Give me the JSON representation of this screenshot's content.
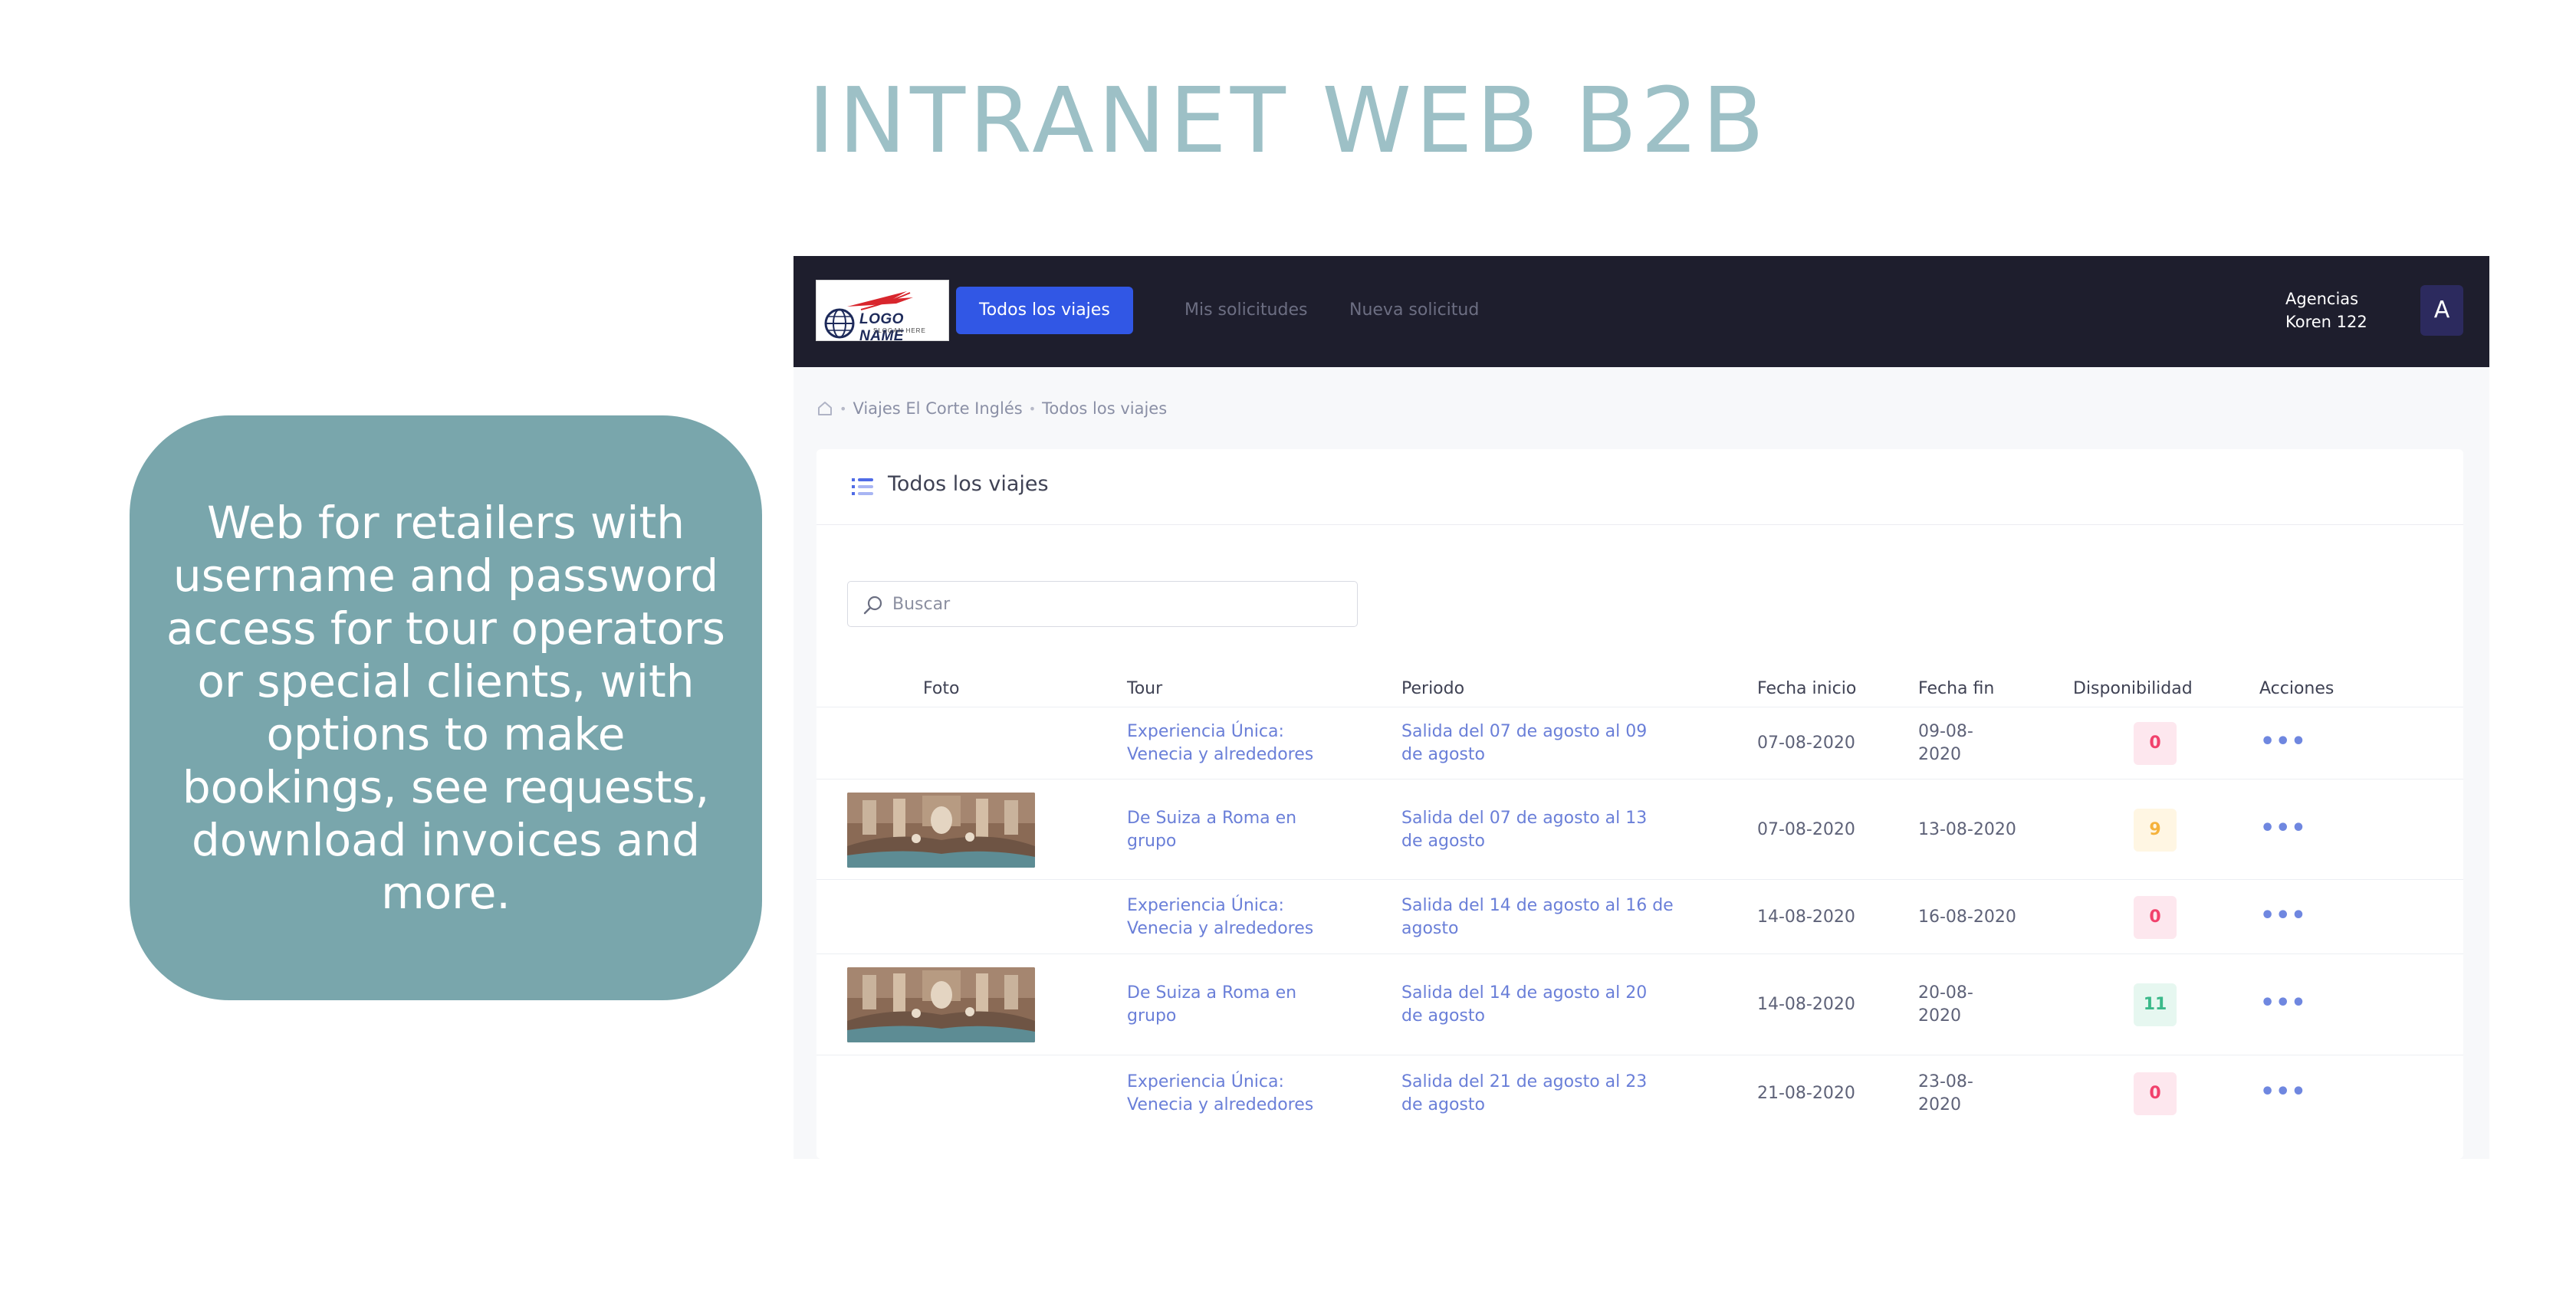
{
  "slide": {
    "title": "INTRANET WEB B2B",
    "description": "Web for retailers  with username and password access for tour operators or special clients, with options to make bookings, see requests, download invoices and more."
  },
  "navbar": {
    "logo": {
      "name": "LOGO NAME",
      "slogan": "SLOGAN HERE"
    },
    "items": [
      {
        "label": "Todos los viajes",
        "active": true
      },
      {
        "label": "Mis solicitudes",
        "active": false
      },
      {
        "label": "Nueva solicitud",
        "active": false
      }
    ],
    "user": {
      "line1": "Agencias",
      "line2": "Koren 122"
    },
    "avatar_letter": "A"
  },
  "breadcrumb": {
    "items": [
      "Viajes El Corte Inglés",
      "Todos los viajes"
    ]
  },
  "card": {
    "title": "Todos los viajes",
    "search_placeholder": "Buscar"
  },
  "table": {
    "headers": {
      "foto": "Foto",
      "tour": "Tour",
      "periodo": "Periodo",
      "fecha_inicio": "Fecha inicio",
      "fecha_fin": "Fecha fin",
      "disponibilidad": "Disponibilidad",
      "acciones": "Acciones"
    },
    "rows": [
      {
        "has_photo": false,
        "tour_l1": "Experiencia Única:",
        "tour_l2": "Venecia y alrededores",
        "periodo_l1": "Salida del 07 de agosto al 09",
        "periodo_l2": "de agosto",
        "fecha_inicio": "07-08-2020",
        "fecha_fin_l1": "09-08-",
        "fecha_fin_l2": "2020",
        "disponibilidad": "0",
        "status": "none"
      },
      {
        "has_photo": true,
        "tour_l1": "De Suiza a Roma en",
        "tour_l2": "grupo",
        "periodo_l1": "Salida del 07 de agosto al 13",
        "periodo_l2": "de agosto",
        "fecha_inicio": "07-08-2020",
        "fecha_fin_l1": "13-08-2020",
        "fecha_fin_l2": "",
        "disponibilidad": "9",
        "status": "low"
      },
      {
        "has_photo": false,
        "tour_l1": "Experiencia Única:",
        "tour_l2": "Venecia y alrededores",
        "periodo_l1": "Salida del 14 de agosto al 16 de",
        "periodo_l2": "agosto",
        "fecha_inicio": "14-08-2020",
        "fecha_fin_l1": "16-08-2020",
        "fecha_fin_l2": "",
        "disponibilidad": "0",
        "status": "none"
      },
      {
        "has_photo": true,
        "tour_l1": "De Suiza a Roma en",
        "tour_l2": "grupo",
        "periodo_l1": "Salida del 14 de agosto al 20",
        "periodo_l2": "de agosto",
        "fecha_inicio": "14-08-2020",
        "fecha_fin_l1": "20-08-",
        "fecha_fin_l2": "2020",
        "disponibilidad": "11",
        "status": "ok"
      },
      {
        "has_photo": false,
        "tour_l1": "Experiencia Única:",
        "tour_l2": "Venecia y alrededores",
        "periodo_l1": "Salida del 21 de agosto al 23",
        "periodo_l2": "de agosto",
        "fecha_inicio": "21-08-2020",
        "fecha_fin_l1": "23-08-",
        "fecha_fin_l2": "2020",
        "disponibilidad": "0",
        "status": "none"
      }
    ],
    "actions_glyph": "•••"
  },
  "colors": {
    "title": "#9dc0c6",
    "bubble": "#79a6ac",
    "navbar": "#1e1e2d",
    "primary": "#3157e5",
    "link": "#6a7fd8",
    "badge_none_bg": "#fde7ee",
    "badge_none_fg": "#f1416c",
    "badge_low_bg": "#fff6e3",
    "badge_low_fg": "#f5b23c",
    "badge_ok_bg": "#e6f7f0",
    "badge_ok_fg": "#3bb98a"
  }
}
